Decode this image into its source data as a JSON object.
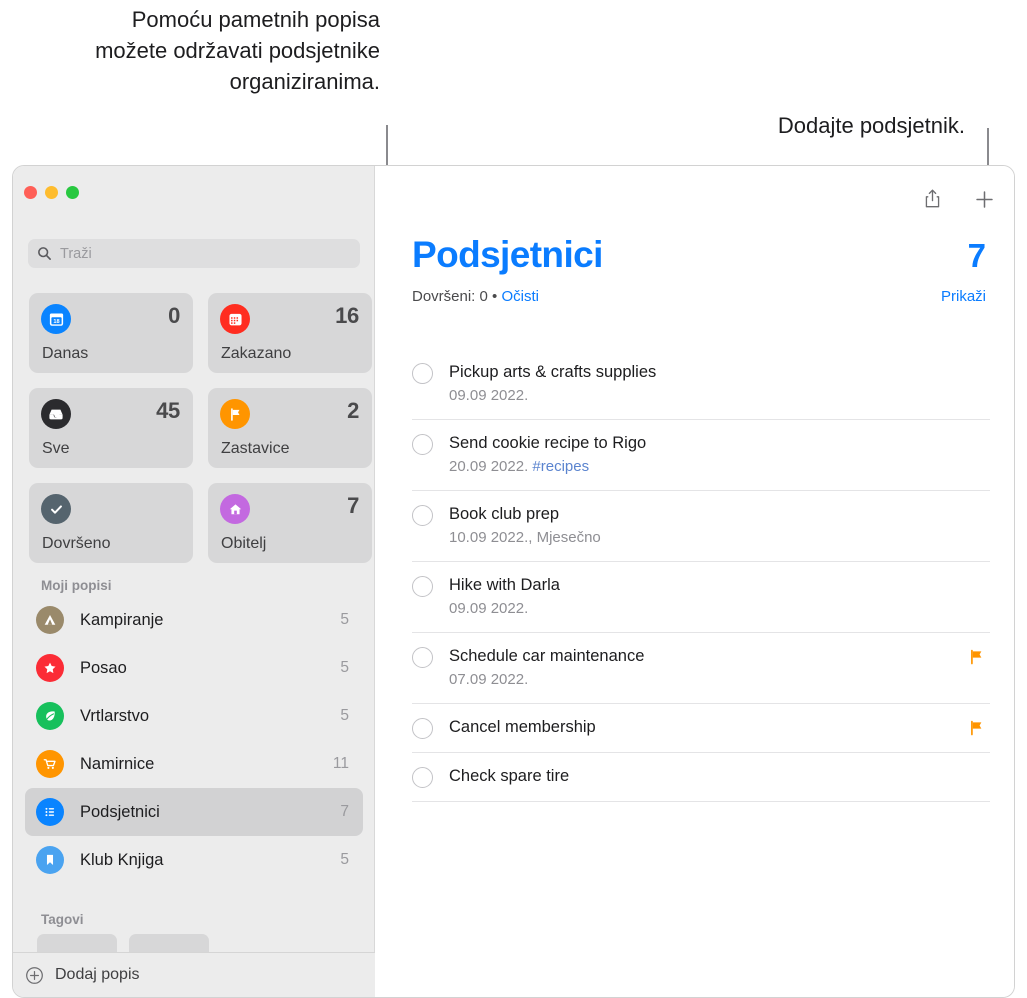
{
  "callouts": {
    "left": "Pomoću pametnih popisa možete održavati podsjetnike organiziranima.",
    "right": "Dodajte podsjetnik."
  },
  "window": {
    "traffic_lights": [
      "close-red",
      "minimize-yellow",
      "zoom-green"
    ]
  },
  "sidebar": {
    "search": {
      "placeholder": "Traži",
      "icon": "search-icon"
    },
    "smart_lists": [
      {
        "name": "Danas",
        "count": "0",
        "icon": "calendar-day-icon",
        "color": "#0a84ff"
      },
      {
        "name": "Zakazano",
        "count": "16",
        "icon": "calendar-icon",
        "color": "#ff2d20"
      },
      {
        "name": "Sve",
        "count": "45",
        "icon": "inbox-tray-icon",
        "color": "#2b2b2e"
      },
      {
        "name": "Zastavice",
        "count": "2",
        "icon": "flag-icon",
        "color": "#ff9500"
      },
      {
        "name": "Dovršeno",
        "count": "",
        "icon": "checkmark-icon",
        "color": "#55646e"
      },
      {
        "name": "Obitelj",
        "count": "7",
        "icon": "house-icon",
        "color": "#c museum"
      }
    ],
    "my_lists_header": "Moji popisi",
    "lists": [
      {
        "name": "Kampiranje",
        "count": "5",
        "icon": "tent-icon",
        "color": "#9a8a6b"
      },
      {
        "name": "Posao",
        "count": "5",
        "icon": "star-icon",
        "color": "#fb2c36"
      },
      {
        "name": "Vrtlarstvo",
        "count": "5",
        "icon": "leaf-icon",
        "color": "#17c05c"
      },
      {
        "name": "Namirnice",
        "count": "11",
        "icon": "cart-icon",
        "color": "#ff9500"
      },
      {
        "name": "Podsjetnici",
        "count": "7",
        "icon": "list-bullet-icon",
        "color": "#0a84ff",
        "selected": true
      },
      {
        "name": "Klub Knjiga",
        "count": "5",
        "icon": "bookmark-icon",
        "color": "#4aa3f0"
      }
    ],
    "tags_header": "Tagovi",
    "tag_pills": [
      "",
      ""
    ],
    "add_list": {
      "label": "Dodaj popis",
      "icon": "plus-circle-icon"
    }
  },
  "main": {
    "toolbar": [
      {
        "name": "share-icon",
        "label": ""
      },
      {
        "name": "add-reminder-icon",
        "label": "+"
      }
    ],
    "title": "Podsjetnici",
    "title_count": "7",
    "completed_label": "Dovršeni: 0",
    "separator": "•",
    "clear_label": "Očisti",
    "show_label": "Prikaži",
    "reminders": [
      {
        "title": "Pickup arts & crafts supplies",
        "date": "09.09 2022.",
        "tag": "",
        "flagged": false
      },
      {
        "title": "Send cookie recipe to Rigo",
        "date": "20.09 2022.",
        "tag": "#recipes",
        "flagged": false
      },
      {
        "title": "Book club prep",
        "date": "10.09 2022., Mjesečno",
        "tag": "",
        "flagged": false
      },
      {
        "title": "Hike with Darla",
        "date": "09.09 2022.",
        "tag": "",
        "flagged": false
      },
      {
        "title": "Schedule car maintenance",
        "date": "07.09 2022.",
        "tag": "",
        "flagged": true
      },
      {
        "title": "Cancel membership",
        "date": "",
        "tag": "",
        "flagged": true
      },
      {
        "title": "Check spare tire",
        "date": "",
        "tag": "",
        "flagged": false
      }
    ]
  },
  "colors": {
    "accent": "#0a7cff",
    "flag": "#ff9500",
    "tag": "#5b84cf"
  }
}
